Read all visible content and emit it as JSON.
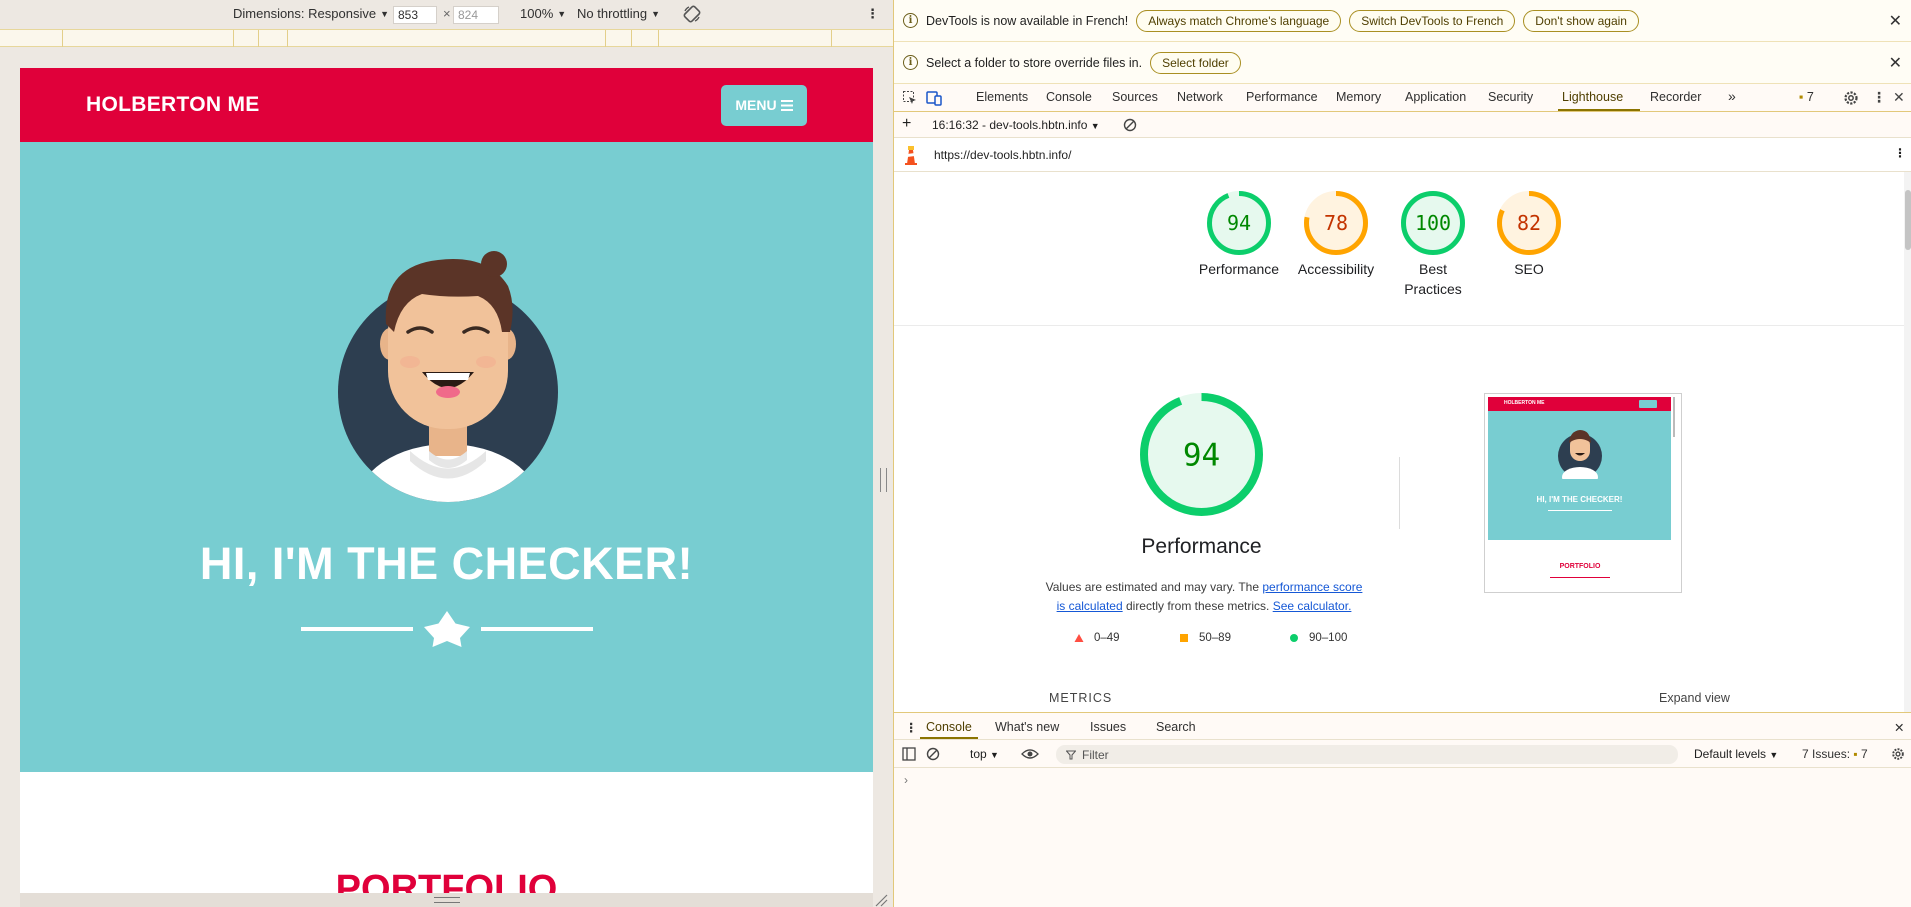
{
  "device_toolbar": {
    "dimensions_label": "Dimensions: Responsive",
    "width_value": "853",
    "times": "×",
    "height_placeholder": "824",
    "zoom": "100%",
    "throttling": "No throttling",
    "more": "⋮"
  },
  "site": {
    "logo": "HOLBERTON ME",
    "menu_label": "MENU",
    "hero_title": "HI, I'M THE CHECKER!",
    "portfolio_title": "PORTFOLIO",
    "colors": {
      "brand_red": "#e0003a",
      "teal": "#78cdd1",
      "navy": "#2d3e50"
    }
  },
  "infobars": {
    "language": {
      "message": "DevTools is now available in French!",
      "buttons": [
        "Always match Chrome's language",
        "Switch DevTools to French",
        "Don't show again"
      ]
    },
    "overrides": {
      "message": "Select a folder to store override files in.",
      "button": "Select folder"
    }
  },
  "devtools": {
    "tabs": [
      "Elements",
      "Console",
      "Sources",
      "Network",
      "Performance",
      "Memory",
      "Application",
      "Security",
      "Lighthouse",
      "Recorder"
    ],
    "active_tab": "Lighthouse",
    "overflow": "»",
    "issues_count": "7",
    "report_selector": "16:16:32 - dev-tools.hbtn.info",
    "url": "https://dev-tools.hbtn.info/"
  },
  "lighthouse": {
    "scores": [
      {
        "label": "Performance",
        "score": 94,
        "color": "#0cce6b"
      },
      {
        "label": "Accessibility",
        "score": 78,
        "color": "#ffa400"
      },
      {
        "label": "Best Practices",
        "score": 100,
        "color": "#0cce6b"
      },
      {
        "label": "SEO",
        "score": 82,
        "color": "#ffa400"
      }
    ],
    "main_score": 94,
    "main_title": "Performance",
    "note_prefix": "Values are estimated and may vary. The ",
    "note_link1": "performance score is calculated",
    "note_mid": " directly from these metrics. ",
    "note_link2": "See calculator.",
    "legend": [
      {
        "range": "0–49",
        "color": "#ff4e42",
        "shape": "triangle"
      },
      {
        "range": "50–89",
        "color": "#ffa400",
        "shape": "square"
      },
      {
        "range": "90–100",
        "color": "#0cce6b",
        "shape": "circle"
      }
    ],
    "metrics_title": "METRICS",
    "expand_view": "Expand view",
    "thumbnail": {
      "logo": "HOLBERTON ME",
      "hero_title": "HI, I'M THE CHECKER!",
      "portfolio": "PORTFOLIO"
    }
  },
  "drawer": {
    "tabs": [
      "Console",
      "What's new",
      "Issues",
      "Search"
    ],
    "active_tab": "Console",
    "context": "top",
    "filter_placeholder": "Filter",
    "levels": "Default levels",
    "issues_label": "7 Issues:",
    "issues_count": "7",
    "prompt": "›"
  }
}
